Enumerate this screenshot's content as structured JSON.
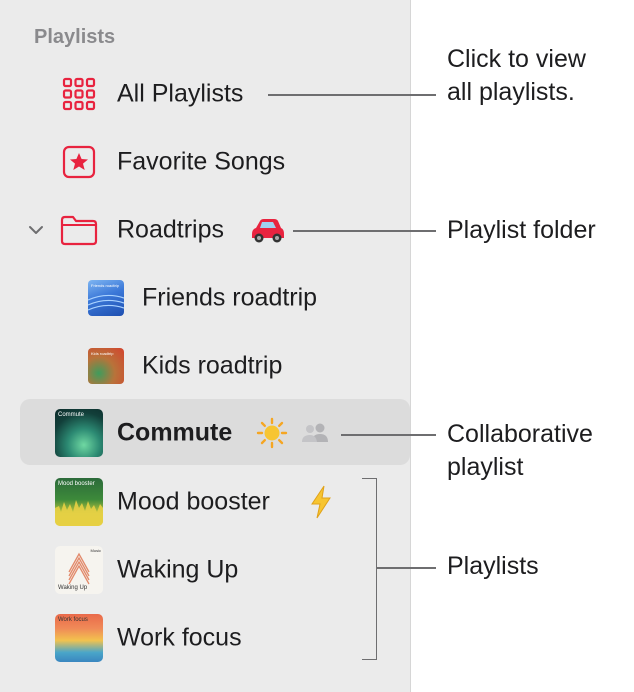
{
  "sidebar": {
    "section_title": "Playlists",
    "items": [
      {
        "label": "All Playlists"
      },
      {
        "label": "Favorite Songs"
      },
      {
        "label": "Roadtrips"
      },
      {
        "label": "Friends roadtrip",
        "art_text": "Friends roadtrip"
      },
      {
        "label": "Kids roadtrip",
        "art_text": "Kids roadtrip"
      },
      {
        "label": "Commute",
        "art_text": "Commute"
      },
      {
        "label": "Mood booster",
        "art_text": "Mood booster"
      },
      {
        "label": "Waking Up",
        "art_text": "Waking Up",
        "art_corner": "Music"
      },
      {
        "label": "Work focus",
        "art_text": "Work focus"
      }
    ]
  },
  "callouts": {
    "all_playlists": [
      "Click to view",
      "all playlists."
    ],
    "folder": "Playlist folder",
    "collaborative": [
      "Collaborative",
      "playlist"
    ],
    "playlists": "Playlists"
  },
  "icons": [
    "grid-icon",
    "star-icon",
    "folder-icon",
    "chevron-down-icon",
    "car-icon",
    "sun-icon",
    "people-icon",
    "lightning-icon"
  ],
  "colors": {
    "accent": "#e8233f",
    "sidebar_bg": "#ebebeb",
    "selected_bg": "#dcdcdc"
  }
}
